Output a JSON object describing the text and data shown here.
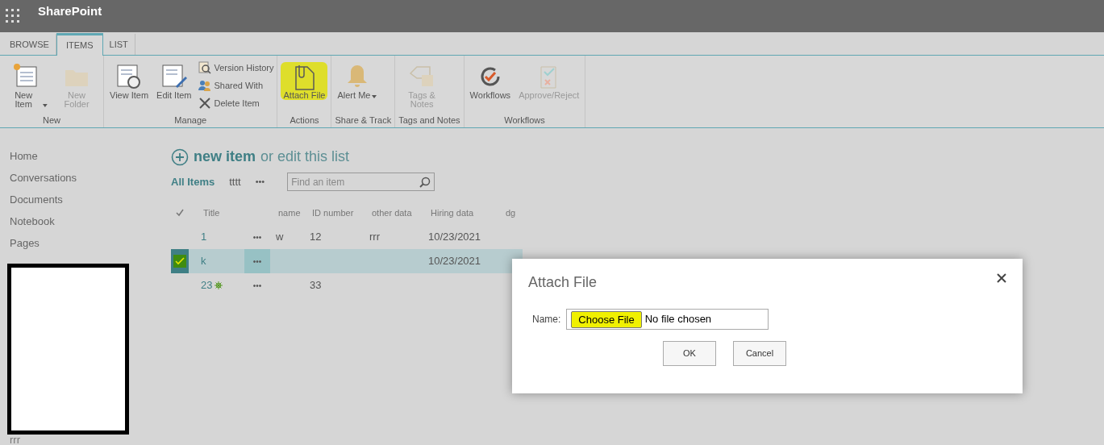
{
  "app_bar": {
    "title": "SharePoint"
  },
  "ribbon": {
    "tabs": [
      {
        "label": "BROWSE",
        "selected": false
      },
      {
        "label": "ITEMS",
        "selected": true
      },
      {
        "label": "LIST",
        "selected": false
      }
    ],
    "groups": [
      {
        "label": "New",
        "buttons": [
          {
            "kind": "large",
            "label": "New Item",
            "dropdown": true,
            "disabled": false,
            "highlighted": false
          },
          {
            "kind": "large",
            "label": "New Folder",
            "dropdown": false,
            "disabled": true,
            "highlighted": false
          }
        ]
      },
      {
        "label": "Manage",
        "buttons": [
          {
            "kind": "large",
            "label": "View Item",
            "dropdown": false,
            "disabled": false,
            "highlighted": false
          },
          {
            "kind": "large",
            "label": "Edit Item",
            "dropdown": false,
            "disabled": false,
            "highlighted": false
          },
          {
            "kind": "small",
            "label": "Version History",
            "disabled": false
          },
          {
            "kind": "small",
            "label": "Shared With",
            "disabled": false
          },
          {
            "kind": "small",
            "label": "Delete Item",
            "disabled": false
          }
        ]
      },
      {
        "label": "Actions",
        "buttons": [
          {
            "kind": "large",
            "label": "Attach File",
            "dropdown": false,
            "disabled": false,
            "highlighted": true
          }
        ]
      },
      {
        "label": "Share & Track",
        "buttons": [
          {
            "kind": "large",
            "label": "Alert Me",
            "dropdown": true,
            "disabled": false,
            "highlighted": false
          }
        ]
      },
      {
        "label": "Tags and Notes",
        "buttons": [
          {
            "kind": "large",
            "label": "Tags & Notes",
            "dropdown": false,
            "disabled": true,
            "highlighted": false
          }
        ]
      },
      {
        "label": "Workflows",
        "buttons": [
          {
            "kind": "large",
            "label": "Workflows",
            "dropdown": false,
            "disabled": false,
            "highlighted": false
          },
          {
            "kind": "large",
            "label": "Approve/Reject",
            "dropdown": false,
            "disabled": true,
            "highlighted": false
          }
        ]
      }
    ]
  },
  "sidebar": {
    "items": [
      "Home",
      "Conversations",
      "Documents",
      "Notebook",
      "Pages"
    ],
    "bottom_item": "rrr"
  },
  "list": {
    "new_item": "new item",
    "edit_text": "or edit this list",
    "views": [
      {
        "label": "All Items",
        "selected": true
      },
      {
        "label": "tttt",
        "selected": false
      }
    ],
    "more": "•••",
    "search": {
      "placeholder": "Find an item"
    },
    "columns": [
      "Title",
      "name",
      "ID number",
      "other data",
      "Hiring data",
      "dg"
    ],
    "rows": [
      {
        "selected": false,
        "new": false,
        "cells": [
          "1",
          "w",
          "12",
          "rrr",
          "10/23/2021"
        ]
      },
      {
        "selected": true,
        "new": false,
        "cells": [
          "k",
          "",
          "",
          "",
          "10/23/2021"
        ]
      },
      {
        "selected": false,
        "new": true,
        "cells": [
          "23",
          "",
          "33",
          "",
          ""
        ]
      }
    ]
  },
  "dialog": {
    "title": "Attach File",
    "field_label": "Name:",
    "choose_button": "Choose File",
    "choose_highlighted": true,
    "file_status": "No file chosen",
    "buttons": [
      "OK",
      "Cancel"
    ]
  }
}
